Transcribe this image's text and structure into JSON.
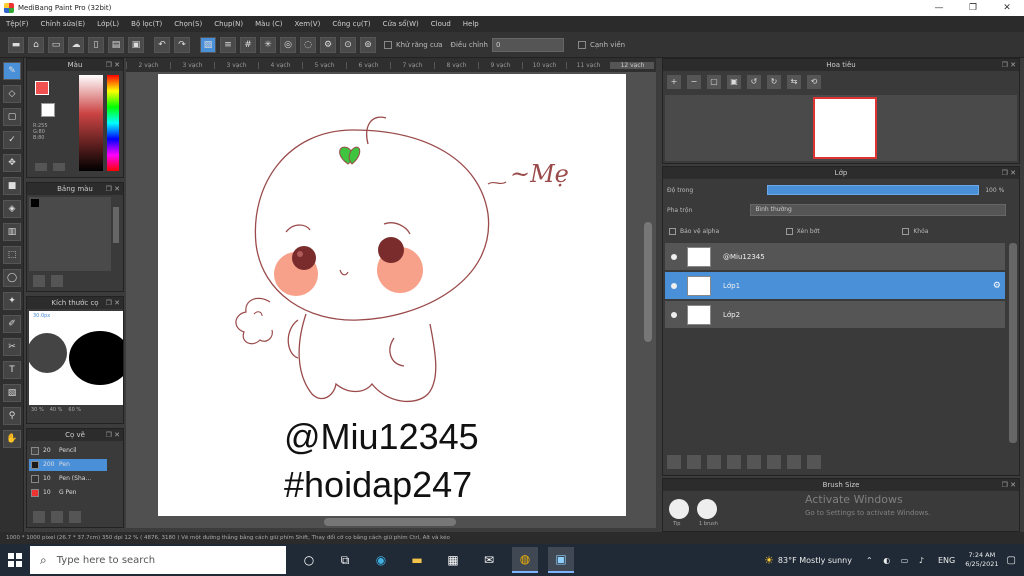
{
  "window": {
    "title": "MediBang Paint Pro (32bit)",
    "controls": [
      "—",
      "❐",
      "✕"
    ]
  },
  "menu": [
    "Tệp(F)",
    "Chỉnh sửa(E)",
    "Lớp(L)",
    "Bộ lọc(T)",
    "Chọn(S)",
    "Chụp(N)",
    "Màu (C)",
    "Xem(V)",
    "Công cụ(T)",
    "Cửa sổ(W)",
    "Cloud",
    "Help"
  ],
  "toolbar": {
    "auto_label": "Khử răng cưa",
    "correction_label": "Điều chỉnh",
    "correction_value": "0",
    "snap_label": "Cạnh viền"
  },
  "ruler": [
    "2 vạch",
    "3 vạch",
    "3 vạch",
    "4 vạch",
    "5 vạch",
    "6 vạch",
    "7 vạch",
    "8 vạch",
    "9 vạch",
    "10 vạch",
    "11 vạch",
    "12 vạch"
  ],
  "color_panel": {
    "title": "Màu",
    "fg_color": "#f05050",
    "bg_color": "#ffffff",
    "values": "R:255\nG:80\nB:80"
  },
  "palette_panel": {
    "title": "Bảng màu"
  },
  "brush_size_panel": {
    "title": "Kích thước cọ",
    "value": "30.0px",
    "footer": [
      "30 %",
      "40 %",
      "60 %"
    ]
  },
  "brush_panel": {
    "title": "Cọ vẽ",
    "rows": [
      {
        "size": "20",
        "name": "Pencil",
        "active": false,
        "color": "#444"
      },
      {
        "size": "200",
        "name": "Pen",
        "active": true,
        "color": "#1a1a1a"
      },
      {
        "size": "10",
        "name": "Pen (Sha...",
        "active": false,
        "color": "#333"
      },
      {
        "size": "10",
        "name": "G Pen",
        "active": false,
        "color": "#e33"
      }
    ]
  },
  "canvas": {
    "handwriting": "~Mẹ",
    "signature_1": "@Miu12345",
    "signature_2": "#hoidap247"
  },
  "navigator": {
    "title": "Hoa tiêu"
  },
  "layers": {
    "title": "Lớp",
    "opacity_label": "Độ trong",
    "opacity_value": "100 %",
    "opacity": 1.0,
    "blend_label": "Pha trộn",
    "blend_value": "Bình thường",
    "check_1": "Bảo vệ alpha",
    "check_2": "Xén bớt",
    "check_3": "Khóa",
    "items": [
      {
        "name": "@Miu12345",
        "active": false
      },
      {
        "name": "Lớp1",
        "active": true
      },
      {
        "name": "Lớp2",
        "active": false
      }
    ]
  },
  "brush_list": {
    "title": "Brush Size",
    "labels": [
      "Tip",
      "1 brush"
    ],
    "activation_title": "Activate Windows",
    "activation_sub": "Go to Settings to activate Windows."
  },
  "status": "1000 * 1000 pixel   (26.7 * 37.7cm)   350 dpi   12 %   ( 4876, 3180 )   Vẽ một đường thẳng bằng cách giữ phím Shift, Thay đổi cỡ cọ bằng cách giữ phím Ctrl, Alt và kéo",
  "taskbar": {
    "search_placeholder": "Type here to search",
    "weather": "83°F  Mostly sunny",
    "lang": "ENG",
    "time": "7:24 AM",
    "date": "6/25/2021"
  }
}
